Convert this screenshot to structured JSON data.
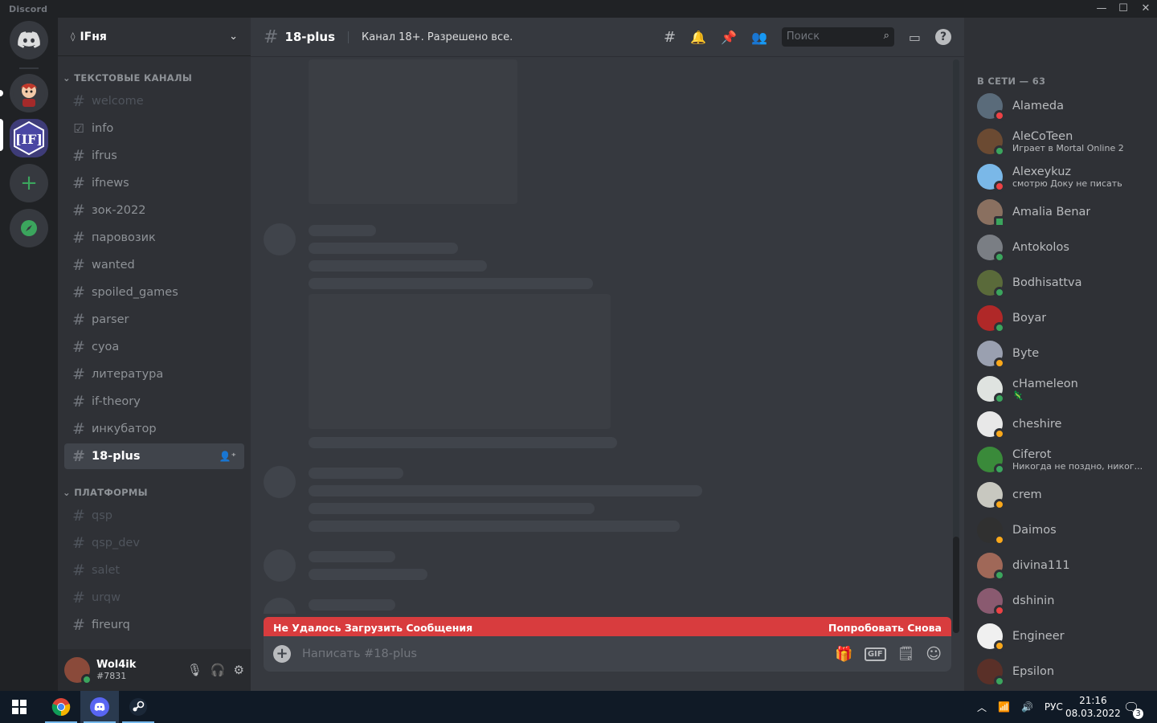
{
  "app": {
    "title": "Discord",
    "minimize": "—",
    "maximize": "☐",
    "close": "✕"
  },
  "server": {
    "name": "IFня"
  },
  "categories": {
    "text": "ТЕКСТОВЫЕ КАНАЛЫ",
    "platforms": "ПЛАТФОРМЫ"
  },
  "channels": [
    {
      "name": "welcome"
    },
    {
      "name": "info"
    },
    {
      "name": "ifrus"
    },
    {
      "name": "ifnews"
    },
    {
      "name": "зок-2022"
    },
    {
      "name": "паровозик"
    },
    {
      "name": "wanted"
    },
    {
      "name": "spoiled_games"
    },
    {
      "name": "parser"
    },
    {
      "name": "cyoa"
    },
    {
      "name": "литература"
    },
    {
      "name": "if-theory"
    },
    {
      "name": "инкубатор"
    },
    {
      "name": "18-plus"
    }
  ],
  "platform_channels": [
    {
      "name": "qsp"
    },
    {
      "name": "qsp_dev"
    },
    {
      "name": "salet"
    },
    {
      "name": "urqw"
    },
    {
      "name": "fireurq"
    }
  ],
  "user": {
    "name": "Wol4ik",
    "tag": "#7831"
  },
  "channel_header": {
    "name": "18-plus",
    "topic": "Канал 18+. Разрешено все."
  },
  "search": {
    "placeholder": "Поиск"
  },
  "error": {
    "message": "Не Удалось Загрузить Сообщения",
    "retry": "Попробовать Снова"
  },
  "composer": {
    "placeholder": "Написать #18-plus",
    "gif": "GIF"
  },
  "members_header": "В СЕТИ — 63",
  "members": [
    {
      "name": "Alameda",
      "activity": "",
      "status": "dnd",
      "color": "#5a6b7a"
    },
    {
      "name": "AleCoTeen",
      "activity": "Играет в Mortal Online 2",
      "status": "online",
      "color": "#6b4a32"
    },
    {
      "name": "Alexeykuz",
      "activity": "смотрю Доку не писать",
      "status": "dnd",
      "color": "#7ab8e8"
    },
    {
      "name": "Amalia Benar",
      "activity": "",
      "status": "mobile",
      "color": "#8a7060"
    },
    {
      "name": "Antokolos",
      "activity": "",
      "status": "online",
      "color": "#7a7e84"
    },
    {
      "name": "Bodhisattva",
      "activity": "",
      "status": "online",
      "color": "#5a6a3a"
    },
    {
      "name": "Boyar",
      "activity": "",
      "status": "online",
      "color": "#b02828"
    },
    {
      "name": "Byte",
      "activity": "",
      "status": "idle",
      "color": "#9aa0b0"
    },
    {
      "name": "cHameleon",
      "activity": "🦎",
      "status": "online",
      "color": "#dfe3e0"
    },
    {
      "name": "cheshire",
      "activity": "",
      "status": "idle",
      "color": "#e8e8e8"
    },
    {
      "name": "Ciferot",
      "activity": "Никогда не поздно, никог...",
      "status": "online",
      "color": "#3a8a3a"
    },
    {
      "name": "crem",
      "activity": "",
      "status": "idle",
      "color": "#c8c8c0"
    },
    {
      "name": "Daimos",
      "activity": "",
      "status": "idle",
      "color": "#303030"
    },
    {
      "name": "divina111",
      "activity": "",
      "status": "online",
      "color": "#a06858"
    },
    {
      "name": "dshinin",
      "activity": "",
      "status": "dnd",
      "color": "#8a5a70"
    },
    {
      "name": "Engineer",
      "activity": "",
      "status": "idle",
      "color": "#f0f0f0"
    },
    {
      "name": "Epsilon",
      "activity": "",
      "status": "online",
      "color": "#5a3028"
    }
  ],
  "status_colors": {
    "online": "#3ba55d",
    "idle": "#faa81a",
    "dnd": "#ed4245",
    "mobile": "#3ba55d"
  },
  "taskbar": {
    "lang": "РУС",
    "time": "21:16",
    "date": "08.03.2022",
    "notifications": "3"
  }
}
